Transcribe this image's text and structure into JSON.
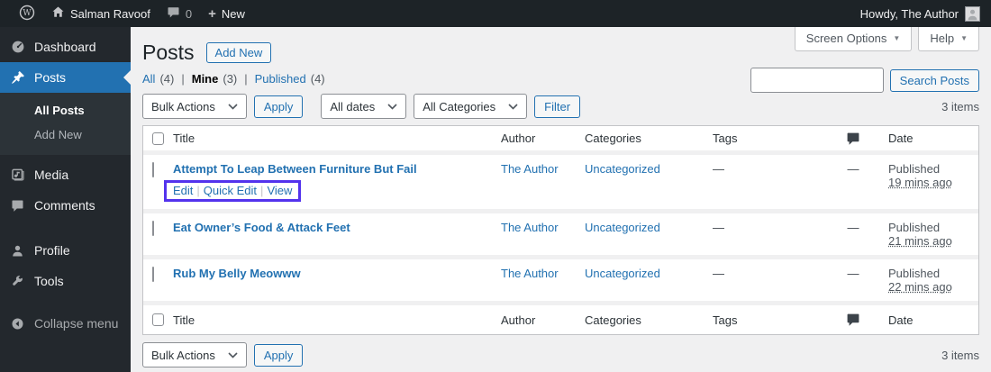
{
  "admin_bar": {
    "site_name": "Salman Ravoof",
    "comments_count": "0",
    "new_label": "New",
    "howdy": "Howdy, The Author"
  },
  "sidebar": {
    "dashboard": "Dashboard",
    "posts": "Posts",
    "all_posts": "All Posts",
    "add_new": "Add New",
    "media": "Media",
    "comments": "Comments",
    "profile": "Profile",
    "tools": "Tools",
    "collapse": "Collapse menu"
  },
  "page": {
    "title": "Posts",
    "add_new_button": "Add New",
    "screen_options": "Screen Options",
    "help": "Help",
    "search_button": "Search Posts",
    "items_count": "3 items",
    "views": {
      "all": "All",
      "all_count": "(4)",
      "mine": "Mine",
      "mine_count": "(3)",
      "published": "Published",
      "published_count": "(4)",
      "separator": "|"
    }
  },
  "toolbar": {
    "bulk_actions": "Bulk Actions",
    "apply": "Apply",
    "all_dates": "All dates",
    "all_categories": "All Categories",
    "filter": "Filter"
  },
  "table": {
    "columns": {
      "title": "Title",
      "author": "Author",
      "categories": "Categories",
      "tags": "Tags",
      "date": "Date"
    },
    "row_actions": {
      "edit": "Edit",
      "quick_edit": "Quick Edit",
      "view": "View",
      "separator": "|"
    },
    "rows": [
      {
        "title": "Attempt To Leap Between Furniture But Fail",
        "author": "The Author",
        "category": "Uncategorized",
        "tags": "—",
        "comments": "—",
        "status": "Published",
        "time": "19 mins ago"
      },
      {
        "title": "Eat Owner’s Food & Attack Feet",
        "author": "The Author",
        "category": "Uncategorized",
        "tags": "—",
        "comments": "—",
        "status": "Published",
        "time": "21 mins ago"
      },
      {
        "title": "Rub My Belly Meowww",
        "author": "The Author",
        "category": "Uncategorized",
        "tags": "—",
        "comments": "—",
        "status": "Published",
        "time": "22 mins ago"
      }
    ]
  },
  "colors": {
    "accent": "#2271b1",
    "annotation_box": "#5333ed",
    "admin_bar_bg": "#1d2327",
    "sidebar_bg": "#23282d"
  }
}
